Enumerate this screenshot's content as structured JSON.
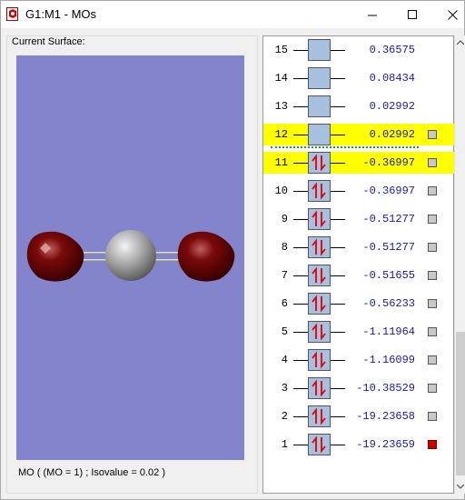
{
  "window": {
    "title": "G1:M1 - MOs"
  },
  "surface": {
    "label": "Current Surface:",
    "status": "MO ( (MO = 1) ; Isovalue = 0.02 )",
    "background_color": "#8484cc"
  },
  "orbitals": [
    {
      "num": "15",
      "energy": "0.36575",
      "occupied": false,
      "highlighted": false,
      "has_check": false,
      "check_color": ""
    },
    {
      "num": "14",
      "energy": "0.08434",
      "occupied": false,
      "highlighted": false,
      "has_check": false,
      "check_color": ""
    },
    {
      "num": "13",
      "energy": "0.02992",
      "occupied": false,
      "highlighted": false,
      "has_check": false,
      "check_color": ""
    },
    {
      "num": "12",
      "energy": "0.02992",
      "occupied": false,
      "highlighted": true,
      "has_check": true,
      "check_color": "gray"
    },
    {
      "num": "11",
      "energy": "-0.36997",
      "occupied": true,
      "highlighted": true,
      "has_check": true,
      "check_color": "gray"
    },
    {
      "num": "10",
      "energy": "-0.36997",
      "occupied": true,
      "highlighted": false,
      "has_check": true,
      "check_color": "gray"
    },
    {
      "num": "9",
      "energy": "-0.51277",
      "occupied": true,
      "highlighted": false,
      "has_check": true,
      "check_color": "gray"
    },
    {
      "num": "8",
      "energy": "-0.51277",
      "occupied": true,
      "highlighted": false,
      "has_check": true,
      "check_color": "gray"
    },
    {
      "num": "7",
      "energy": "-0.51655",
      "occupied": true,
      "highlighted": false,
      "has_check": true,
      "check_color": "gray"
    },
    {
      "num": "6",
      "energy": "-0.56233",
      "occupied": true,
      "highlighted": false,
      "has_check": true,
      "check_color": "gray"
    },
    {
      "num": "5",
      "energy": "-1.11964",
      "occupied": true,
      "highlighted": false,
      "has_check": true,
      "check_color": "gray"
    },
    {
      "num": "4",
      "energy": "-1.16099",
      "occupied": true,
      "highlighted": false,
      "has_check": true,
      "check_color": "gray"
    },
    {
      "num": "3",
      "energy": "-10.38529",
      "occupied": true,
      "highlighted": false,
      "has_check": true,
      "check_color": "gray"
    },
    {
      "num": "2",
      "energy": "-19.23658",
      "occupied": true,
      "highlighted": false,
      "has_check": true,
      "check_color": "gray"
    },
    {
      "num": "1",
      "energy": "-19.23659",
      "occupied": true,
      "highlighted": false,
      "has_check": true,
      "check_color": "red"
    }
  ],
  "colors": {
    "highlight": "#ffff00",
    "energy_text": "#1a1aa0",
    "homo_lumo_divider": "#1aa040",
    "orbital_box": "#a8c0e0",
    "electron_arrow": "#e00000",
    "oxygen": "#7a0a0a",
    "carbon": "#a8a8a8"
  },
  "icons": {
    "app": "gaussview-icon",
    "minimize": "minimize-icon",
    "maximize": "maximize-icon",
    "close": "close-icon"
  }
}
